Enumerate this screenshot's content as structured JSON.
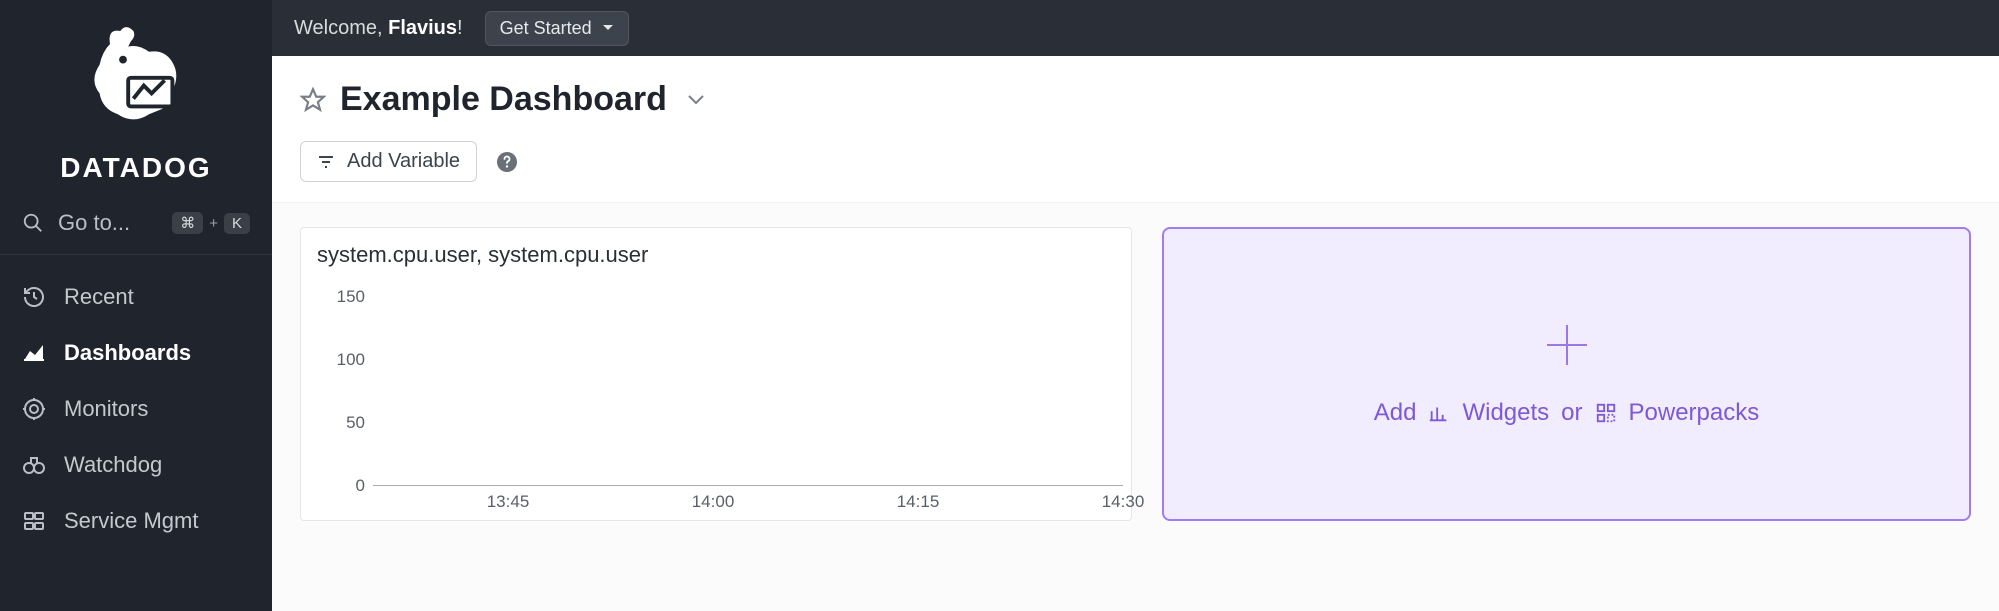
{
  "brand": "DATADOG",
  "sidebar": {
    "goto_label": "Go to...",
    "kbd_cmd": "⌘",
    "kbd_plus": "+",
    "kbd_k": "K",
    "items": [
      {
        "label": "Recent",
        "active": false
      },
      {
        "label": "Dashboards",
        "active": true
      },
      {
        "label": "Monitors",
        "active": false
      },
      {
        "label": "Watchdog",
        "active": false
      },
      {
        "label": "Service Mgmt",
        "active": false
      }
    ]
  },
  "topbar": {
    "welcome_prefix": "Welcome, ",
    "welcome_name": "Flavius",
    "welcome_suffix": "!",
    "get_started": "Get Started"
  },
  "page": {
    "title": "Example Dashboard",
    "add_variable": "Add Variable"
  },
  "widget": {
    "title": "system.cpu.user, system.cpu.user"
  },
  "dropzone": {
    "add": "Add",
    "widgets": "Widgets",
    "or": "or",
    "powerpacks": "Powerpacks"
  },
  "chart_data": {
    "type": "line",
    "title": "system.cpu.user, system.cpu.user",
    "xlabel": "",
    "ylabel": "",
    "ylim": [
      0,
      160
    ],
    "x_ticks": [
      "13:45",
      "14:00",
      "14:15",
      "14:30"
    ],
    "y_ticks": [
      0,
      50,
      100,
      150
    ],
    "series": [
      {
        "name": "system.cpu.user",
        "values": []
      },
      {
        "name": "system.cpu.user",
        "values": []
      }
    ]
  }
}
